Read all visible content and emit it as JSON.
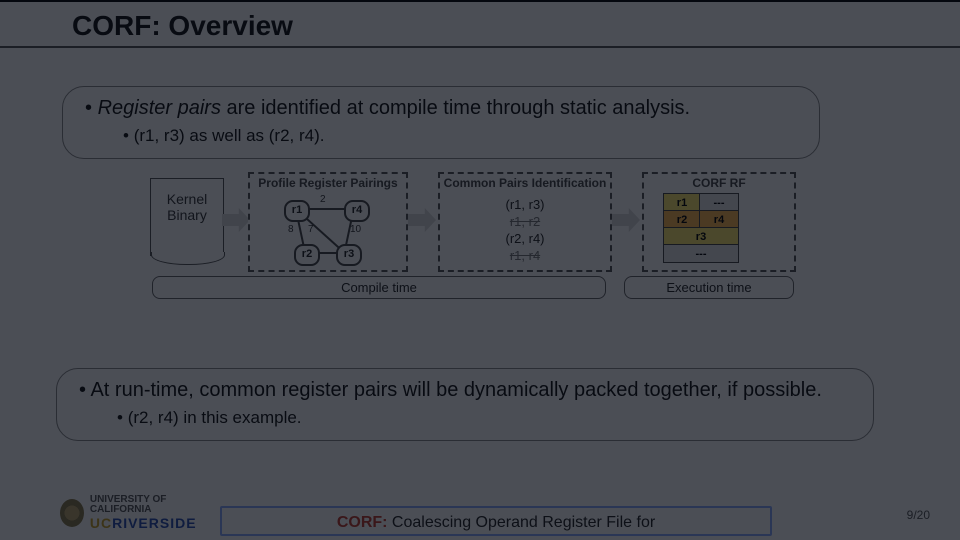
{
  "title": "CORF: Overview",
  "bullet1": {
    "main_italic": "Register pairs",
    "main_rest": " are identified at compile time through static analysis.",
    "sub": "(r1, r3) as well as (r2, r4)."
  },
  "bullet2": {
    "main": "At run-time, common register pairs will be dynamically packed together, if possible.",
    "sub": "(r2, r4) in this example."
  },
  "flow": {
    "kernel": [
      "Kernel",
      "Binary"
    ],
    "pairings_hdr": "Profile Register Pairings",
    "commons_hdr": "Common Pairs Identification",
    "corfrf_hdr": "CORF RF",
    "graph": {
      "nodes": {
        "r1": "r1",
        "r2": "r2",
        "r3": "r3",
        "r4": "r4"
      },
      "edge_labels": {
        "r1r4": "2",
        "r1r2": "8",
        "r1r3": "7",
        "r4r3": "10"
      }
    },
    "pairs": {
      "p1": "(r1, r3)",
      "p2": "r1, r2",
      "p3": "(r2, r4)",
      "p4": "r1, r4"
    },
    "rf": {
      "row1": [
        "r1",
        "---"
      ],
      "row2": [
        "r2",
        "r4"
      ],
      "row3_full": "r3",
      "row4_full": "---"
    },
    "compile_time": "Compile time",
    "exec_time": "Execution time"
  },
  "footer": {
    "corf": "CORF:",
    "rest": " Coalescing Operand Register File for"
  },
  "logo": {
    "uc": "UNIVERSITY OF CALIFORNIA",
    "name": "RIVERSIDE",
    "prefix": "UC"
  },
  "page": {
    "cur": "9",
    "total": "/20"
  }
}
